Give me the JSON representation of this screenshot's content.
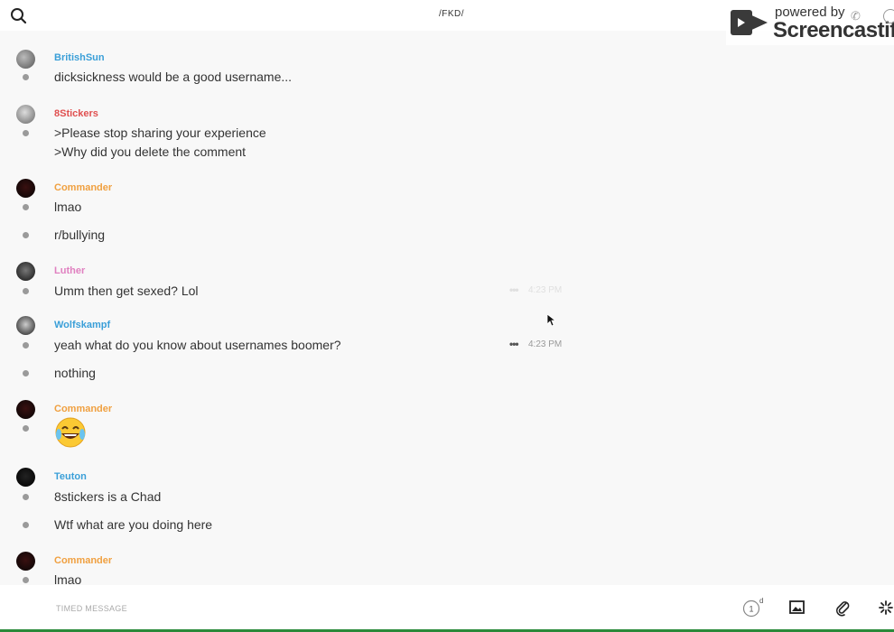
{
  "header": {
    "channel_name": "/FKD/",
    "watermark": {
      "line1": "powered by",
      "line2": "Screencastify"
    }
  },
  "messages": [
    {
      "user": "BritishSun",
      "user_color": "#3a9fd8",
      "text": "dicksickness would be a good username..."
    },
    {
      "user": "8Stickers",
      "user_color": "#e05050",
      "text": ">Please stop sharing your experience",
      "text2": ">Why did you delete the comment"
    },
    {
      "user": "Commander",
      "user_color": "#f0a040",
      "text": "lmao",
      "text2": "r/bullying"
    },
    {
      "user": "Luther",
      "user_color": "#e080c0",
      "text": "Umm then get sexed? Lol",
      "timestamp": "4:23 PM"
    },
    {
      "user": "Wolfskampf",
      "user_color": "#3a9fd8",
      "text": "yeah what do you know about usernames boomer?",
      "timestamp": "4:23 PM",
      "text2": "nothing"
    },
    {
      "user": "Commander",
      "user_color": "#f0a040",
      "emoji": "face-with-tears-of-joy"
    },
    {
      "user": "Teuton",
      "user_color": "#3a9fd8",
      "text": "8stickers is a Chad",
      "text2": "Wtf what are you doing here"
    },
    {
      "user": "Commander",
      "user_color": "#f0a040",
      "text": "lmao"
    }
  ],
  "composer": {
    "placeholder": "TIMED MESSAGE",
    "timer_value": "1",
    "timer_unit": "d"
  },
  "icons": [
    "search-icon",
    "phone-icon",
    "info-icon",
    "timer-icon",
    "image-icon",
    "paperclip-icon",
    "sparkle-icon"
  ],
  "colors": {
    "accent_blue": "#3a9fd8",
    "accent_red": "#e05050",
    "accent_orange": "#f0a040",
    "accent_pink": "#e080c0",
    "bottom_border": "#2a8a3a"
  }
}
